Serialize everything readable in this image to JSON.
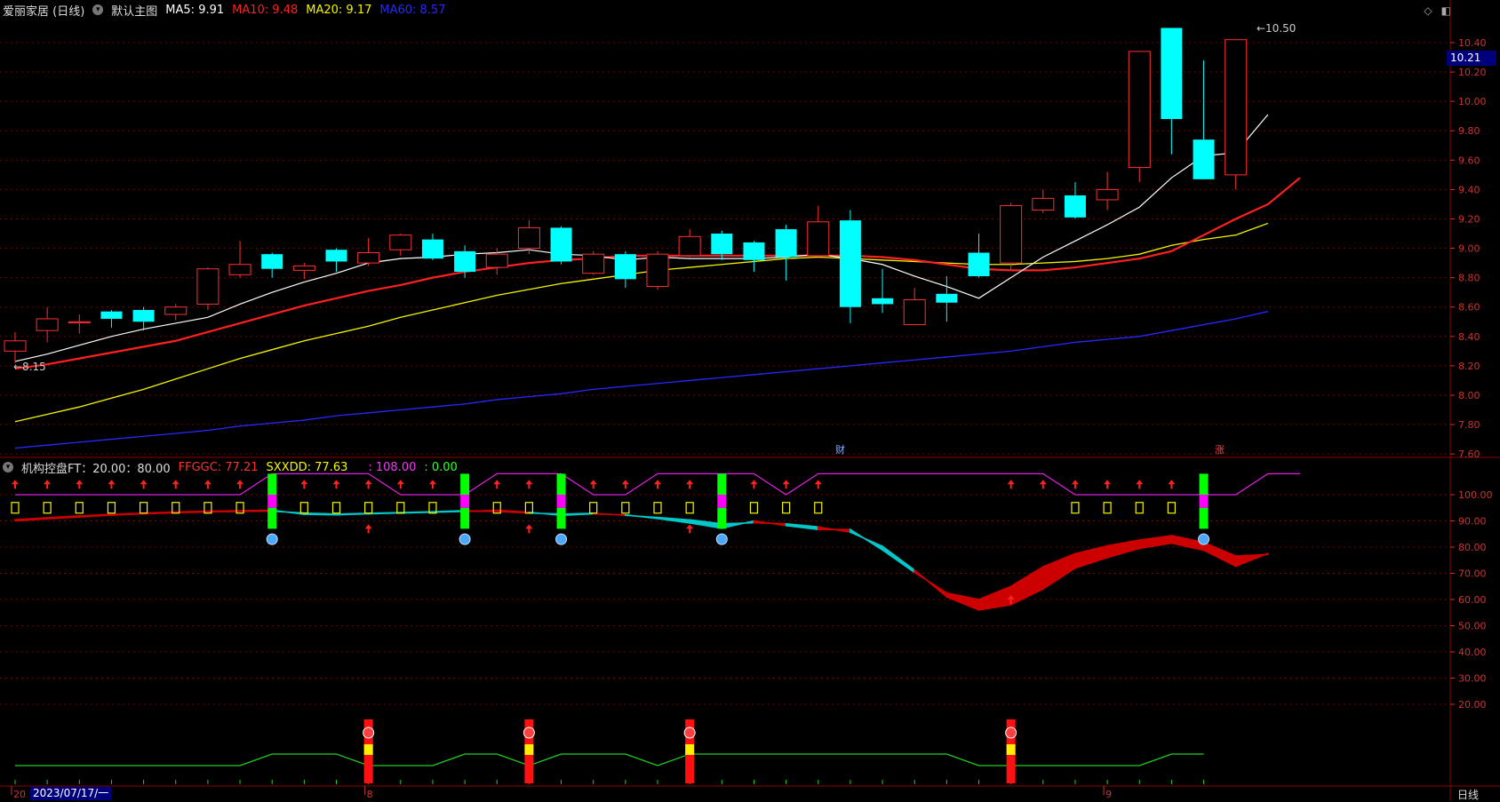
{
  "header": {
    "stock": "爱丽家居 (日线)",
    "template": "默认主图",
    "ma": [
      {
        "label": "MA5: 9.91",
        "color": "#ffffff"
      },
      {
        "label": "MA10: 9.48",
        "color": "#ff2020"
      },
      {
        "label": "MA20: 9.17",
        "color": "#f5f500"
      },
      {
        "label": "MA60: 8.57",
        "color": "#2828ff"
      }
    ]
  },
  "indicator_header": {
    "name": "机构控盘FT：20.00：80.00",
    "ffggc": "FFGGC: 77.21",
    "sxxdd": "SXXDD: 77.63",
    "extra1": ": 108.00",
    "extra2": ": 0.00"
  },
  "price_box": "10.21",
  "high_label": "10.50",
  "low_label": "8.15",
  "markers": {
    "cai": "财",
    "zhang": "涨"
  },
  "date_box": "2023/07/17/一",
  "month_labels": [
    "20",
    "8",
    "9"
  ],
  "freq": "日线",
  "colors": {
    "up": "#ff3030",
    "down": "#00ffff",
    "ma5": "#ffffff",
    "ma10": "#ff2020",
    "ma20": "#f5f500",
    "ma60": "#2828ff",
    "grid": "#7a0000"
  },
  "chart_data": {
    "type": "candlestick",
    "price_axis": {
      "ticks": [
        "10.40",
        "10.20",
        "10.00",
        "9.80",
        "9.60",
        "9.40",
        "9.20",
        "9.00",
        "8.80",
        "8.60",
        "8.40",
        "8.20",
        "8.00",
        "7.80",
        "7.60"
      ],
      "ylim": [
        7.56,
        10.54
      ]
    },
    "indicator_axis": {
      "ticks": [
        "100.00",
        "90.00",
        "80.00",
        "70.00",
        "60.00",
        "50.00",
        "40.00",
        "30.00",
        "20.00"
      ],
      "ylim": [
        15,
        113
      ]
    },
    "candles": [
      {
        "o": 8.3,
        "c": 8.37,
        "h": 8.43,
        "l": 8.22
      },
      {
        "o": 8.44,
        "c": 8.52,
        "h": 8.6,
        "l": 8.36
      },
      {
        "o": 8.5,
        "c": 8.5,
        "h": 8.55,
        "l": 8.42
      },
      {
        "o": 8.57,
        "c": 8.52,
        "h": 8.58,
        "l": 8.46
      },
      {
        "o": 8.58,
        "c": 8.5,
        "h": 8.6,
        "l": 8.44
      },
      {
        "o": 8.55,
        "c": 8.6,
        "h": 8.62,
        "l": 8.51
      },
      {
        "o": 8.62,
        "c": 8.86,
        "h": 8.87,
        "l": 8.58
      },
      {
        "o": 8.82,
        "c": 8.89,
        "h": 9.05,
        "l": 8.8
      },
      {
        "o": 8.96,
        "c": 8.86,
        "h": 8.97,
        "l": 8.8
      },
      {
        "o": 8.85,
        "c": 8.88,
        "h": 8.9,
        "l": 8.79
      },
      {
        "o": 8.99,
        "c": 8.91,
        "h": 9.0,
        "l": 8.84
      },
      {
        "o": 8.9,
        "c": 8.97,
        "h": 9.07,
        "l": 8.88
      },
      {
        "o": 8.99,
        "c": 9.09,
        "h": 9.1,
        "l": 8.95
      },
      {
        "o": 9.06,
        "c": 8.93,
        "h": 9.1,
        "l": 8.92
      },
      {
        "o": 8.98,
        "c": 8.84,
        "h": 9.02,
        "l": 8.8
      },
      {
        "o": 8.87,
        "c": 8.96,
        "h": 9.0,
        "l": 8.82
      },
      {
        "o": 9.0,
        "c": 9.14,
        "h": 9.19,
        "l": 8.96
      },
      {
        "o": 9.14,
        "c": 8.91,
        "h": 9.15,
        "l": 8.89
      },
      {
        "o": 8.83,
        "c": 8.96,
        "h": 8.98,
        "l": 8.82
      },
      {
        "o": 8.96,
        "c": 8.79,
        "h": 8.98,
        "l": 8.73
      },
      {
        "o": 8.74,
        "c": 8.96,
        "h": 8.98,
        "l": 8.72
      },
      {
        "o": 8.95,
        "c": 9.08,
        "h": 9.13,
        "l": 8.94
      },
      {
        "o": 9.1,
        "c": 8.96,
        "h": 9.12,
        "l": 8.92
      },
      {
        "o": 9.04,
        "c": 8.92,
        "h": 9.05,
        "l": 8.84
      },
      {
        "o": 9.13,
        "c": 8.94,
        "h": 9.16,
        "l": 8.78
      },
      {
        "o": 8.95,
        "c": 9.18,
        "h": 9.29,
        "l": 8.94
      },
      {
        "o": 9.19,
        "c": 8.6,
        "h": 9.26,
        "l": 8.49
      },
      {
        "o": 8.66,
        "c": 8.62,
        "h": 8.86,
        "l": 8.56
      },
      {
        "o": 8.48,
        "c": 8.65,
        "h": 8.73,
        "l": 8.48
      },
      {
        "o": 8.69,
        "c": 8.63,
        "h": 8.81,
        "l": 8.5
      },
      {
        "o": 8.97,
        "c": 8.81,
        "h": 9.1,
        "l": 8.8
      },
      {
        "o": 8.9,
        "c": 9.29,
        "h": 9.31,
        "l": 8.85
      },
      {
        "o": 9.26,
        "c": 9.34,
        "h": 9.4,
        "l": 9.24
      },
      {
        "o": 9.36,
        "c": 9.21,
        "h": 9.45,
        "l": 9.2
      },
      {
        "o": 9.33,
        "c": 9.4,
        "h": 9.52,
        "l": 9.26
      },
      {
        "o": 9.55,
        "c": 10.34,
        "h": 10.34,
        "l": 9.45
      },
      {
        "o": 10.5,
        "c": 9.88,
        "h": 10.5,
        "l": 9.64
      },
      {
        "o": 9.74,
        "c": 9.47,
        "h": 10.28,
        "l": 9.47
      },
      {
        "o": 9.5,
        "c": 10.42,
        "h": 10.42,
        "l": 9.4
      }
    ],
    "ma5": [
      8.23,
      8.28,
      8.34,
      8.4,
      8.45,
      8.49,
      8.53,
      8.62,
      8.7,
      8.77,
      8.83,
      8.9,
      8.93,
      8.94,
      8.96,
      8.97,
      8.99,
      8.96,
      8.95,
      8.92,
      8.94,
      8.93,
      8.93,
      8.93,
      8.94,
      8.96,
      8.93,
      8.89,
      8.81,
      8.74,
      8.66,
      8.8,
      8.94,
      9.05,
      9.16,
      9.28,
      9.48,
      9.63,
      9.65,
      9.91
    ],
    "ma10": [
      8.18,
      8.21,
      8.25,
      8.29,
      8.33,
      8.37,
      8.43,
      8.49,
      8.55,
      8.61,
      8.66,
      8.71,
      8.75,
      8.8,
      8.84,
      8.87,
      8.9,
      8.92,
      8.93,
      8.95,
      8.95,
      8.95,
      8.95,
      8.95,
      8.95,
      8.95,
      8.95,
      8.94,
      8.92,
      8.89,
      8.86,
      8.85,
      8.85,
      8.87,
      8.9,
      8.93,
      8.98,
      9.09,
      9.2,
      9.3,
      9.48
    ],
    "ma20": [
      7.82,
      7.87,
      7.92,
      7.98,
      8.04,
      8.11,
      8.18,
      8.25,
      8.31,
      8.37,
      8.42,
      8.47,
      8.53,
      8.58,
      8.63,
      8.68,
      8.72,
      8.76,
      8.79,
      8.82,
      8.85,
      8.87,
      8.89,
      8.91,
      8.93,
      8.94,
      8.93,
      8.92,
      8.91,
      8.9,
      8.89,
      8.89,
      8.9,
      8.91,
      8.93,
      8.96,
      9.02,
      9.06,
      9.09,
      9.17
    ],
    "ma60": [
      7.64,
      7.66,
      7.68,
      7.7,
      7.72,
      7.74,
      7.76,
      7.79,
      7.81,
      7.83,
      7.86,
      7.88,
      7.9,
      7.92,
      7.94,
      7.97,
      7.99,
      8.01,
      8.04,
      8.06,
      8.08,
      8.1,
      8.12,
      8.14,
      8.16,
      8.18,
      8.2,
      8.22,
      8.24,
      8.26,
      8.28,
      8.3,
      8.33,
      8.36,
      8.38,
      8.4,
      8.44,
      8.48,
      8.52,
      8.57
    ],
    "ffggc": [
      90.5,
      91.2,
      91.9,
      92.5,
      93.0,
      93.4,
      93.7,
      93.9,
      94.1,
      92.5,
      92.3,
      92.7,
      93.0,
      93.3,
      93.6,
      94.1,
      93.3,
      92.1,
      92.7,
      92.3,
      90.9,
      89.2,
      87.2,
      90.0,
      88.2,
      86.7,
      86.7,
      78.9,
      70.3,
      62.5,
      60.0,
      65.0,
      72.5,
      77.5,
      80.5,
      82.7,
      84.4,
      81.8,
      76.6,
      77.2
    ],
    "sxxdd": [
      90.0,
      90.8,
      91.5,
      92.2,
      92.7,
      93.1,
      93.4,
      93.6,
      93.7,
      93.0,
      92.6,
      92.9,
      93.2,
      93.5,
      93.9,
      93.6,
      93.0,
      92.6,
      92.9,
      92.1,
      91.3,
      90.4,
      88.9,
      89.3,
      88.9,
      87.7,
      85.7,
      80.3,
      71.2,
      61.0,
      56.0,
      58.0,
      64.0,
      72.0,
      76.0,
      79.5,
      81.5,
      78.8,
      72.7,
      77.6
    ],
    "line108": [
      100,
      100,
      100,
      100,
      100,
      100,
      100,
      100,
      108,
      108,
      108,
      108,
      100,
      100,
      100,
      108,
      108,
      108,
      100,
      100,
      108,
      108,
      108,
      108,
      100,
      108,
      108,
      108,
      108,
      108,
      108,
      108,
      108,
      100,
      100,
      100,
      100,
      100,
      100,
      108,
      108
    ],
    "signal_bars": [
      8,
      14,
      17,
      22,
      37
    ]
  }
}
